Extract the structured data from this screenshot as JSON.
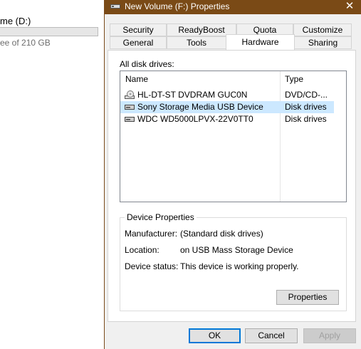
{
  "background_window": {
    "title": "me (D:)",
    "subtitle": "ee of 210 GB"
  },
  "dialog": {
    "title": "New Volume (F:) Properties",
    "close_glyph": "✕",
    "tabs_row1": [
      "Security",
      "ReadyBoost",
      "Quota",
      "Customize"
    ],
    "tabs_row2": [
      "General",
      "Tools",
      "Hardware",
      "Sharing"
    ],
    "active_tab": "Hardware",
    "all_disk_drives_label": "All disk drives:",
    "columns": {
      "name": "Name",
      "type": "Type"
    },
    "drives": [
      {
        "name": "HL-DT-ST DVDRAM GUC0N",
        "type": "DVD/CD-...",
        "icon": "dvd-drive-icon",
        "selected": false
      },
      {
        "name": "Sony Storage Media USB Device",
        "type": "Disk drives",
        "icon": "disk-drive-icon",
        "selected": true
      },
      {
        "name": "WDC WD5000LPVX-22V0TT0",
        "type": "Disk drives",
        "icon": "disk-drive-icon",
        "selected": false
      }
    ],
    "device_properties": {
      "title": "Device Properties",
      "manufacturer_label": "Manufacturer:",
      "manufacturer_value": "(Standard disk drives)",
      "location_label": "Location:",
      "location_value": "on USB Mass Storage Device",
      "status_label": "Device status:",
      "status_value": "This device is working properly.",
      "properties_button": "Properties"
    },
    "buttons": {
      "ok": "OK",
      "cancel": "Cancel",
      "apply": "Apply"
    },
    "colors": {
      "titlebar": "#7a4a16",
      "selection": "#cce8ff",
      "accent": "#0078d7"
    }
  }
}
